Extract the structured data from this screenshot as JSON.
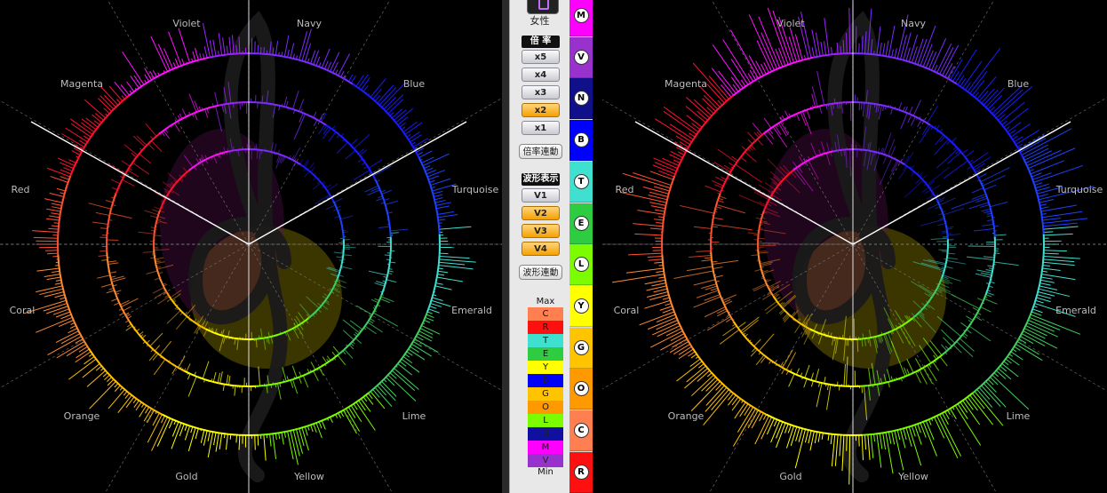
{
  "visualizers": [
    {
      "id": "left",
      "labels": [
        "Violet",
        "Navy",
        "Magenta",
        "Blue",
        "Red",
        "Turquoise",
        "Coral",
        "Emerald",
        "Orange",
        "Lime",
        "Gold",
        "Yellow"
      ],
      "amplitude": 0.55
    },
    {
      "id": "right",
      "labels": [
        "Violet",
        "Navy",
        "Magenta",
        "Blue",
        "Red",
        "Turquoise",
        "Coral",
        "Emerald",
        "Orange",
        "Lime",
        "Gold",
        "Yellow"
      ],
      "amplitude": 0.85
    }
  ],
  "panel": {
    "gender_label": "女性",
    "magnification": {
      "header": "倍 率",
      "buttons": [
        {
          "label": "x5",
          "active": false
        },
        {
          "label": "x4",
          "active": false
        },
        {
          "label": "x3",
          "active": false
        },
        {
          "label": "x2",
          "active": true
        },
        {
          "label": "x1",
          "active": false
        }
      ],
      "link_label": "倍率連動"
    },
    "waveform": {
      "header": "波形表示",
      "buttons": [
        {
          "label": "V1",
          "active": false
        },
        {
          "label": "V2",
          "active": true
        },
        {
          "label": "V3",
          "active": true
        },
        {
          "label": "V4",
          "active": true
        }
      ],
      "link_label": "波形連動"
    },
    "legend": {
      "max_label": "Max",
      "min_label": "Min",
      "items": [
        {
          "letter": "C",
          "color": "#ff7f50"
        },
        {
          "letter": "R",
          "color": "#ff1010"
        },
        {
          "letter": "T",
          "color": "#40e0d0"
        },
        {
          "letter": "E",
          "color": "#2ecc40"
        },
        {
          "letter": "Y",
          "color": "#ffff00"
        },
        {
          "letter": "B",
          "color": "#0000ff"
        },
        {
          "letter": "G",
          "color": "#ffc400"
        },
        {
          "letter": "O",
          "color": "#ff9900"
        },
        {
          "letter": "L",
          "color": "#7cfc00"
        },
        {
          "letter": "N",
          "color": "#1010a0"
        },
        {
          "letter": "M",
          "color": "#ff00ff"
        },
        {
          "letter": "V",
          "color": "#9932cc"
        }
      ]
    }
  },
  "color_buttons": [
    {
      "letter": "M",
      "color": "#ff00ff"
    },
    {
      "letter": "V",
      "color": "#9932cc"
    },
    {
      "letter": "N",
      "color": "#10108a"
    },
    {
      "letter": "B",
      "color": "#0000ff"
    },
    {
      "letter": "T",
      "color": "#40e0d0"
    },
    {
      "letter": "E",
      "color": "#2ecc40"
    },
    {
      "letter": "L",
      "color": "#7cfc00"
    },
    {
      "letter": "Y",
      "color": "#ffff00"
    },
    {
      "letter": "G",
      "color": "#ffc400"
    },
    {
      "letter": "O",
      "color": "#ff9900"
    },
    {
      "letter": "C",
      "color": "#ff7f50"
    },
    {
      "letter": "R",
      "color": "#ff1010"
    }
  ]
}
